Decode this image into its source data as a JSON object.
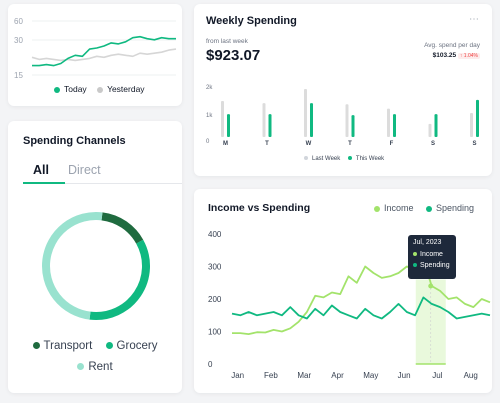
{
  "colors": {
    "green": "#10b981",
    "dark_green": "#1f6b3f",
    "mint": "#99e2cf",
    "lime": "#a3e36b",
    "grey_bar": "#dcdcdc",
    "tooltip_bg": "#1e293b"
  },
  "today_card": {
    "legend": [
      "Today",
      "Yesterday"
    ],
    "chart_data": {
      "type": "line",
      "y_ticks": [
        "60",
        "30",
        "15"
      ],
      "series": [
        {
          "name": "Today",
          "values": [
            12,
            12,
            13,
            12,
            14,
            19,
            22,
            21,
            28,
            29,
            31,
            34,
            33,
            35,
            39,
            40,
            38,
            37,
            39,
            38,
            38
          ]
        },
        {
          "name": "Yesterday",
          "values": [
            20,
            18,
            19,
            18,
            17,
            18,
            17,
            18,
            19,
            21,
            20,
            22,
            23,
            22,
            21,
            24,
            23,
            24,
            25,
            27,
            28
          ]
        }
      ]
    }
  },
  "weekly": {
    "title": "Weekly Spending",
    "subtitle": "from last week",
    "amount": "$923.07",
    "avg_label": "Avg. spend per day",
    "avg_value": "$103.25",
    "avg_change": "↑ 1.04%",
    "menu_icon": "more-horizontal-icon",
    "legend": [
      "Last Week",
      "This Week"
    ],
    "chart_data": {
      "type": "bar",
      "y_ticks": [
        "2k",
        "1k",
        "0"
      ],
      "categories": [
        "M",
        "T",
        "W",
        "T",
        "F",
        "S",
        "S"
      ],
      "series": [
        {
          "name": "Last Week",
          "values": [
            1650,
            1550,
            2200,
            1500,
            1300,
            600,
            1100
          ]
        },
        {
          "name": "This Week",
          "values": [
            1050,
            1050,
            1550,
            1000,
            1050,
            1050,
            1700
          ]
        }
      ],
      "ylim": [
        0,
        2200
      ]
    }
  },
  "channels": {
    "title": "Spending Channels",
    "tabs": [
      "All",
      "Direct"
    ],
    "active_tab": "All",
    "legend": [
      "Transport",
      "Grocery",
      "Rent"
    ],
    "chart_data": {
      "type": "pie",
      "labels": [
        "Transport",
        "Grocery",
        "Rent"
      ],
      "values": [
        15,
        35,
        50
      ]
    }
  },
  "income": {
    "title": "Income vs Spending",
    "legend": [
      "Income",
      "Spending"
    ],
    "tooltip": {
      "title": "Jul, 2023",
      "rows": [
        "Income",
        "Spending"
      ]
    },
    "chart_data": {
      "type": "line",
      "categories": [
        "Jan",
        "Feb",
        "Mar",
        "Apr",
        "May",
        "Jun",
        "Jul",
        "Aug"
      ],
      "y_ticks": [
        "400",
        "300",
        "200",
        "100",
        "0"
      ],
      "ylim": [
        0,
        400
      ],
      "x": [
        0.0,
        0.25,
        0.5,
        0.75,
        1.0,
        1.25,
        1.5,
        1.75,
        2.0,
        2.25,
        2.5,
        2.75,
        3.0,
        3.25,
        3.5,
        3.75,
        4.0,
        4.25,
        4.5,
        4.75,
        5.0,
        5.25,
        5.5,
        5.75,
        6.0,
        6.25,
        6.5,
        6.75,
        7.0,
        7.25,
        7.5,
        7.75
      ],
      "series": [
        {
          "name": "Income",
          "values": [
            95,
            95,
            92,
            98,
            97,
            105,
            100,
            110,
            130,
            160,
            210,
            205,
            220,
            215,
            270,
            250,
            300,
            280,
            265,
            270,
            280,
            300,
            290,
            320,
            240,
            225,
            200,
            205,
            185,
            175,
            200,
            190
          ]
        },
        {
          "name": "Spending",
          "values": [
            155,
            150,
            160,
            150,
            155,
            160,
            150,
            175,
            150,
            140,
            170,
            150,
            180,
            160,
            150,
            140,
            170,
            150,
            140,
            160,
            185,
            160,
            150,
            205,
            185,
            175,
            160,
            140,
            145,
            150,
            155,
            150
          ]
        }
      ]
    }
  }
}
